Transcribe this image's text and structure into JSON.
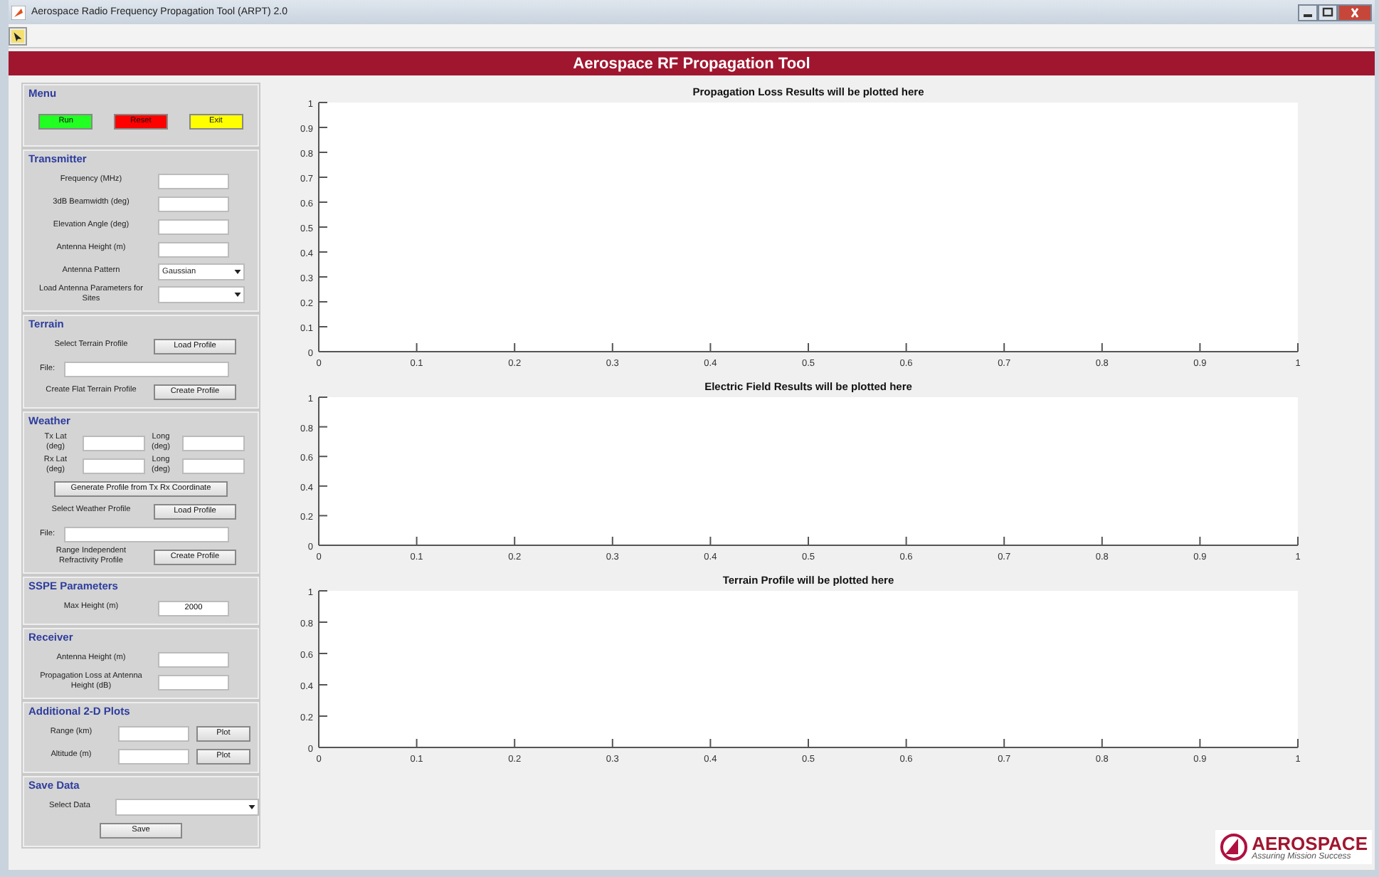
{
  "window": {
    "title": "Aerospace Radio Frequency Propagation Tool (ARPT) 2.0"
  },
  "banner": {
    "title": "Aerospace RF Propagation Tool"
  },
  "sections": [
    {
      "title": "Menu",
      "rows": [
        {
          "kind": "buttons",
          "buttons": [
            {
              "label": "Run",
              "color": "#22ff22"
            },
            {
              "label": "Reset",
              "color": "#ff0000"
            },
            {
              "label": "Exit",
              "color": "#ffff00"
            }
          ]
        }
      ]
    },
    {
      "title": "Transmitter",
      "rows": [
        {
          "kind": "input",
          "label": "Frequency (MHz)"
        },
        {
          "kind": "input",
          "label": "3dB Beamwidth (deg)"
        },
        {
          "kind": "input",
          "label": "Elevation Angle (deg)"
        },
        {
          "kind": "input",
          "label": "Antenna Height (m)"
        },
        {
          "kind": "dropdown",
          "label": "Antenna Pattern",
          "value": "Gaussian"
        },
        {
          "kind": "dropdown",
          "label": "Load Antenna Parameters for Sites"
        }
      ]
    },
    {
      "title": "Terrain",
      "rows": [
        {
          "kind": "button",
          "label": "Select Terrain Profile",
          "button": "Load Profile"
        },
        {
          "kind": "file",
          "label": "File:"
        },
        {
          "kind": "button",
          "label": "Create Flat Terrain Profile",
          "button": "Create Profile"
        }
      ]
    },
    {
      "title": "Weather",
      "rows": [
        {
          "kind": "pair",
          "fields": [
            {
              "label": "Tx Lat (deg)"
            },
            {
              "label": "Long (deg)"
            }
          ]
        },
        {
          "kind": "pair",
          "fields": [
            {
              "label": "Rx Lat (deg)"
            },
            {
              "label": "Long (deg)"
            }
          ]
        },
        {
          "kind": "wide-button",
          "button": "Generate Profile from Tx Rx Coordinate"
        },
        {
          "kind": "button",
          "label": "Select Weather Profile",
          "button": "Load Profile"
        },
        {
          "kind": "file",
          "label": "File:"
        },
        {
          "kind": "button",
          "label": "Range Independent Refractivity Profile",
          "button": "Create Profile"
        }
      ]
    },
    {
      "title": "SSPE Parameters",
      "rows": [
        {
          "kind": "input",
          "label": "Max Height (m)",
          "value": "2000"
        }
      ]
    },
    {
      "title": "Receiver",
      "rows": [
        {
          "kind": "input",
          "label": "Antenna Height (m)"
        },
        {
          "kind": "input",
          "label": "Propagation Loss at Antenna Height (dB)"
        }
      ]
    },
    {
      "title": "Additional 2-D Plots",
      "rows": [
        {
          "kind": "input-button",
          "label": "Range (km)",
          "button": "Plot"
        },
        {
          "kind": "input-button",
          "label": "Altitude (m)",
          "button": "Plot"
        }
      ]
    },
    {
      "title": "Save Data",
      "rows": [
        {
          "kind": "select-wide",
          "label": "Select Data"
        },
        {
          "kind": "center-button",
          "button": "Save"
        }
      ]
    }
  ],
  "charts": [
    {
      "chart_data": {
        "type": "line",
        "title": "Propagation Loss Results will be plotted here",
        "xlim": [
          0,
          1
        ],
        "ylim": [
          0,
          1
        ],
        "xticks": [
          0,
          0.1,
          0.2,
          0.3,
          0.4,
          0.5,
          0.6,
          0.7,
          0.8,
          0.9,
          1
        ],
        "yticks": [
          0,
          0.1,
          0.2,
          0.3,
          0.4,
          0.5,
          0.6,
          0.7,
          0.8,
          0.9,
          1
        ]
      }
    },
    {
      "chart_data": {
        "type": "line",
        "title": "Electric Field Results will be plotted here",
        "xlim": [
          0,
          1
        ],
        "ylim": [
          0,
          1
        ],
        "xticks": [
          0,
          0.1,
          0.2,
          0.3,
          0.4,
          0.5,
          0.6,
          0.7,
          0.8,
          0.9,
          1
        ],
        "yticks": [
          0,
          0.2,
          0.4,
          0.6,
          0.8,
          1
        ]
      }
    },
    {
      "chart_data": {
        "type": "line",
        "title": "Terrain Profile will be plotted here",
        "xlim": [
          0,
          1
        ],
        "ylim": [
          0,
          1
        ],
        "xticks": [
          0,
          0.1,
          0.2,
          0.3,
          0.4,
          0.5,
          0.6,
          0.7,
          0.8,
          0.9,
          1
        ],
        "yticks": [
          0,
          0.2,
          0.4,
          0.6,
          0.8,
          1
        ]
      }
    }
  ],
  "logo": {
    "name": "AEROSPACE",
    "tagline": "Assuring Mission Success"
  }
}
